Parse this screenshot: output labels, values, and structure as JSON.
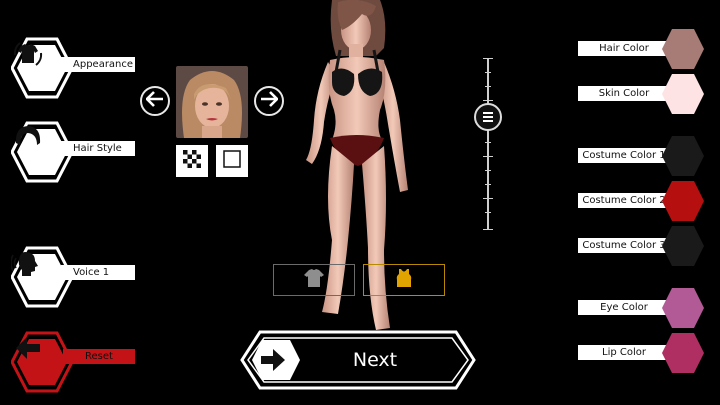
{
  "left_menu": {
    "appearance": "Appearance",
    "hair_style": "Hair Style",
    "voice": "Voice 1",
    "reset": "Reset"
  },
  "color_menu": [
    {
      "label": "Hair Color",
      "color": "#a77c76"
    },
    {
      "label": "Skin Color",
      "color": "#fde3e3"
    },
    {
      "label": "Costume Color 1",
      "color": "#1a1a1a"
    },
    {
      "label": "Costume Color 2",
      "color": "#b50f0f"
    },
    {
      "label": "Costume Color 3",
      "color": "#1a1a1a"
    },
    {
      "label": "Eye Color",
      "color": "#b25a96"
    },
    {
      "label": "Lip Color",
      "color": "#b02f62"
    }
  ],
  "next_button": {
    "label": "Next"
  },
  "colors": {
    "accent_red": "#c41317",
    "tab_active": "#e0a300",
    "tab_inactive": "#6b6b6b"
  }
}
